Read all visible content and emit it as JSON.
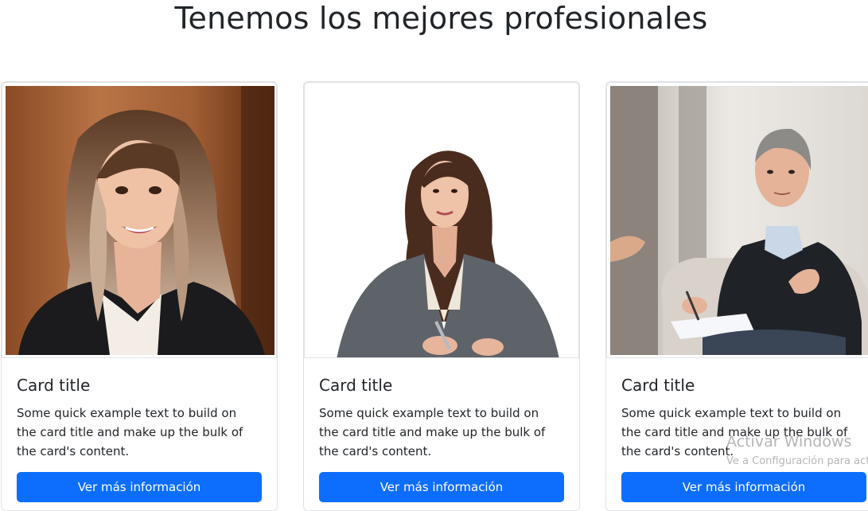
{
  "page": {
    "heading": "Tenemos los mejores profesionales"
  },
  "cards": [
    {
      "image_alt": "Retrato de profesional mujer con cabello largo y chaqueta negra",
      "title": "Card title",
      "text": "Some quick example text to build on the card title and make up the bulk of the card's content.",
      "button_label": "Ver más información"
    },
    {
      "image_alt": "Profesional mujer con chaqueta gris tomando notas",
      "title": "Card title",
      "text": "Some quick example text to build on the card title and make up the bulk of the card's content.",
      "button_label": "Ver más información"
    },
    {
      "image_alt": "Profesional hombre con suéter oscuro en sesión de terapia",
      "title": "Card title",
      "text": "Some quick example text to build on the card title and make up the bulk of the card's content.",
      "button_label": "Ver más información"
    }
  ],
  "watermark": {
    "title": "Activar Windows",
    "subtitle": "Ve a Configuración para activar Windows."
  },
  "colors": {
    "primary": "#0d6efd",
    "text": "#212529",
    "border": "#dfe2e6"
  }
}
